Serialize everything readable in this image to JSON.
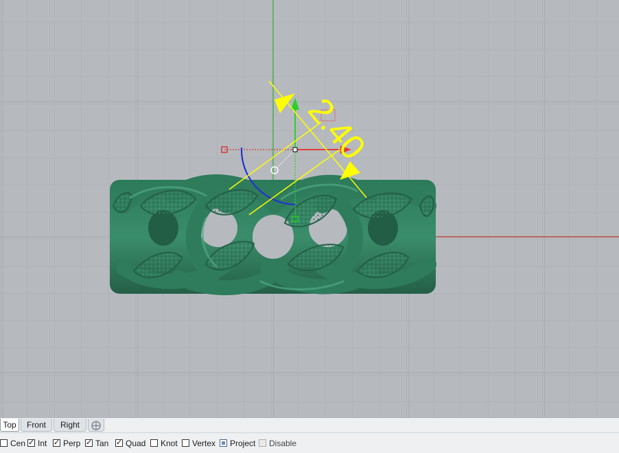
{
  "viewport": {
    "dimension_text": "2.40",
    "colors": {
      "background": "#b6babe",
      "grid_minor": "#a9adb1",
      "grid_major": "#9da1a5",
      "ring": "#2f7a5c",
      "dimension": "#ffff00",
      "x_axis": "#c0392b",
      "y_axis": "#33aa33"
    }
  },
  "tabs": [
    {
      "label": "Top",
      "active": true
    },
    {
      "label": "Front",
      "active": false
    },
    {
      "label": "Right",
      "active": false
    }
  ],
  "tab_add_icon": "add-viewport-icon",
  "osnaps": [
    {
      "label": "Cen",
      "checked": false
    },
    {
      "label": "Int",
      "checked": true
    },
    {
      "label": "Perp",
      "checked": true
    },
    {
      "label": "Tan",
      "checked": true
    },
    {
      "label": "Quad",
      "checked": true
    },
    {
      "label": "Knot",
      "checked": false
    },
    {
      "label": "Vertex",
      "checked": false
    },
    {
      "label": "Project",
      "checked": true
    },
    {
      "label": "Disable",
      "checked": false
    }
  ]
}
